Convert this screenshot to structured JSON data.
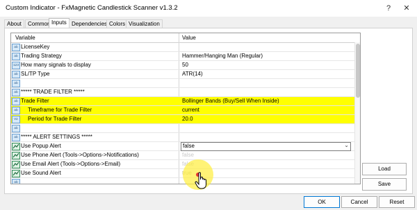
{
  "window": {
    "title": "Custom Indicator - FxMagnetic Candlestick Scanner v1.3.2",
    "help_label": "?",
    "close_label": "✕"
  },
  "tabs": [
    "About",
    "Common",
    "Inputs",
    "Dependencies",
    "Colors",
    "Visualization"
  ],
  "active_tab": "Inputs",
  "grid": {
    "columns": {
      "variable": "Variable",
      "value": "Value"
    },
    "rows": [
      {
        "icon": "ab",
        "label": "LicenseKey",
        "value": ""
      },
      {
        "icon": "ab",
        "label": "Trading Strategy",
        "value": "Hammer/Hanging Man (Regular)"
      },
      {
        "icon": "123",
        "label": "How many signals to display",
        "value": "50"
      },
      {
        "icon": "ab",
        "label": "SL/TP Type",
        "value": "ATR(14)"
      },
      {
        "icon": "ab",
        "label": "",
        "value": ""
      },
      {
        "icon": "ab",
        "label": "***** TRADE FILTER *****",
        "value": ""
      },
      {
        "icon": "ab",
        "label": "Trade Filter",
        "value": "Bollinger Bands (Buy/Sell When Inside)"
      },
      {
        "icon": "ab",
        "label": "Timeframe for Trade Filter",
        "value": "current"
      },
      {
        "icon": "V2",
        "label": "Period for Trade Filter",
        "value": "20.0"
      },
      {
        "icon": "ab",
        "label": "",
        "value": ""
      },
      {
        "icon": "ab",
        "label": "***** ALERT SETTINGS *****",
        "value": ""
      },
      {
        "icon": "enum",
        "label": "Use Popup Alert",
        "value": "false"
      },
      {
        "icon": "enum",
        "label": "Use Phone Alert (Tools->Options->Notifications)",
        "value": "false"
      },
      {
        "icon": "enum",
        "label": "Use Email Alert (Tools->Options->Email)",
        "value": "false"
      },
      {
        "icon": "enum",
        "label": "Use Sound Alert",
        "value": "true"
      },
      {
        "icon": "ab",
        "label": "",
        "value": ""
      }
    ]
  },
  "side_buttons": {
    "load": "Load",
    "save": "Save"
  },
  "footer_buttons": {
    "ok": "OK",
    "cancel": "Cancel",
    "reset": "Reset"
  },
  "colors": {
    "highlight": "#ffff00",
    "accent": "#0078d4"
  }
}
